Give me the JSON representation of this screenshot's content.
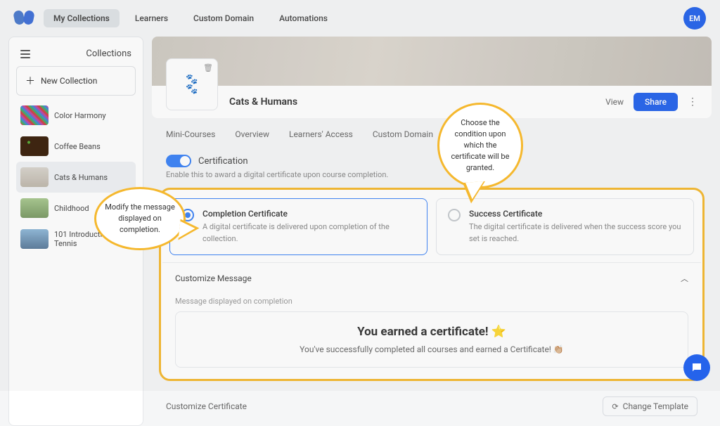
{
  "nav": {
    "tabs": [
      "My Collections",
      "Learners",
      "Custom Domain",
      "Automations"
    ],
    "avatar": "EM"
  },
  "sidebar": {
    "title": "Collections",
    "new_label": "New Collection",
    "items": [
      {
        "label": "Color Harmony"
      },
      {
        "label": "Coffee Beans"
      },
      {
        "label": "Cats & Humans"
      },
      {
        "label": "Childhood"
      },
      {
        "label": "101 Introduction to Tennis"
      }
    ]
  },
  "header": {
    "title": "Cats & Humans",
    "view": "View",
    "share": "Share"
  },
  "subtabs": [
    "Mini-Courses",
    "Overview",
    "Learners' Access",
    "Custom Domain"
  ],
  "cert": {
    "title": "Certification",
    "sub": "Enable this to award a digital certificate upon course completion.",
    "opt1_title": "Completion Certificate",
    "opt1_desc": "A digital certificate is delivered upon completion of the collection.",
    "opt2_title": "Success Certificate",
    "opt2_desc": "The digital certificate is delivered when the success score you set is reached."
  },
  "custom": {
    "title": "Customize Message",
    "sub": "Message displayed on completion",
    "msg_title": "You earned a certificate! ⭐",
    "msg_body": "You've successfully completed all courses and earned a Certificate! 👏🏼"
  },
  "footer": {
    "customize": "Customize Certificate",
    "change_tpl": "Change Template"
  },
  "callouts": {
    "c1": "Choose the condition upon which the certificate will be granted.",
    "c2": "Modify the message displayed on completion."
  }
}
